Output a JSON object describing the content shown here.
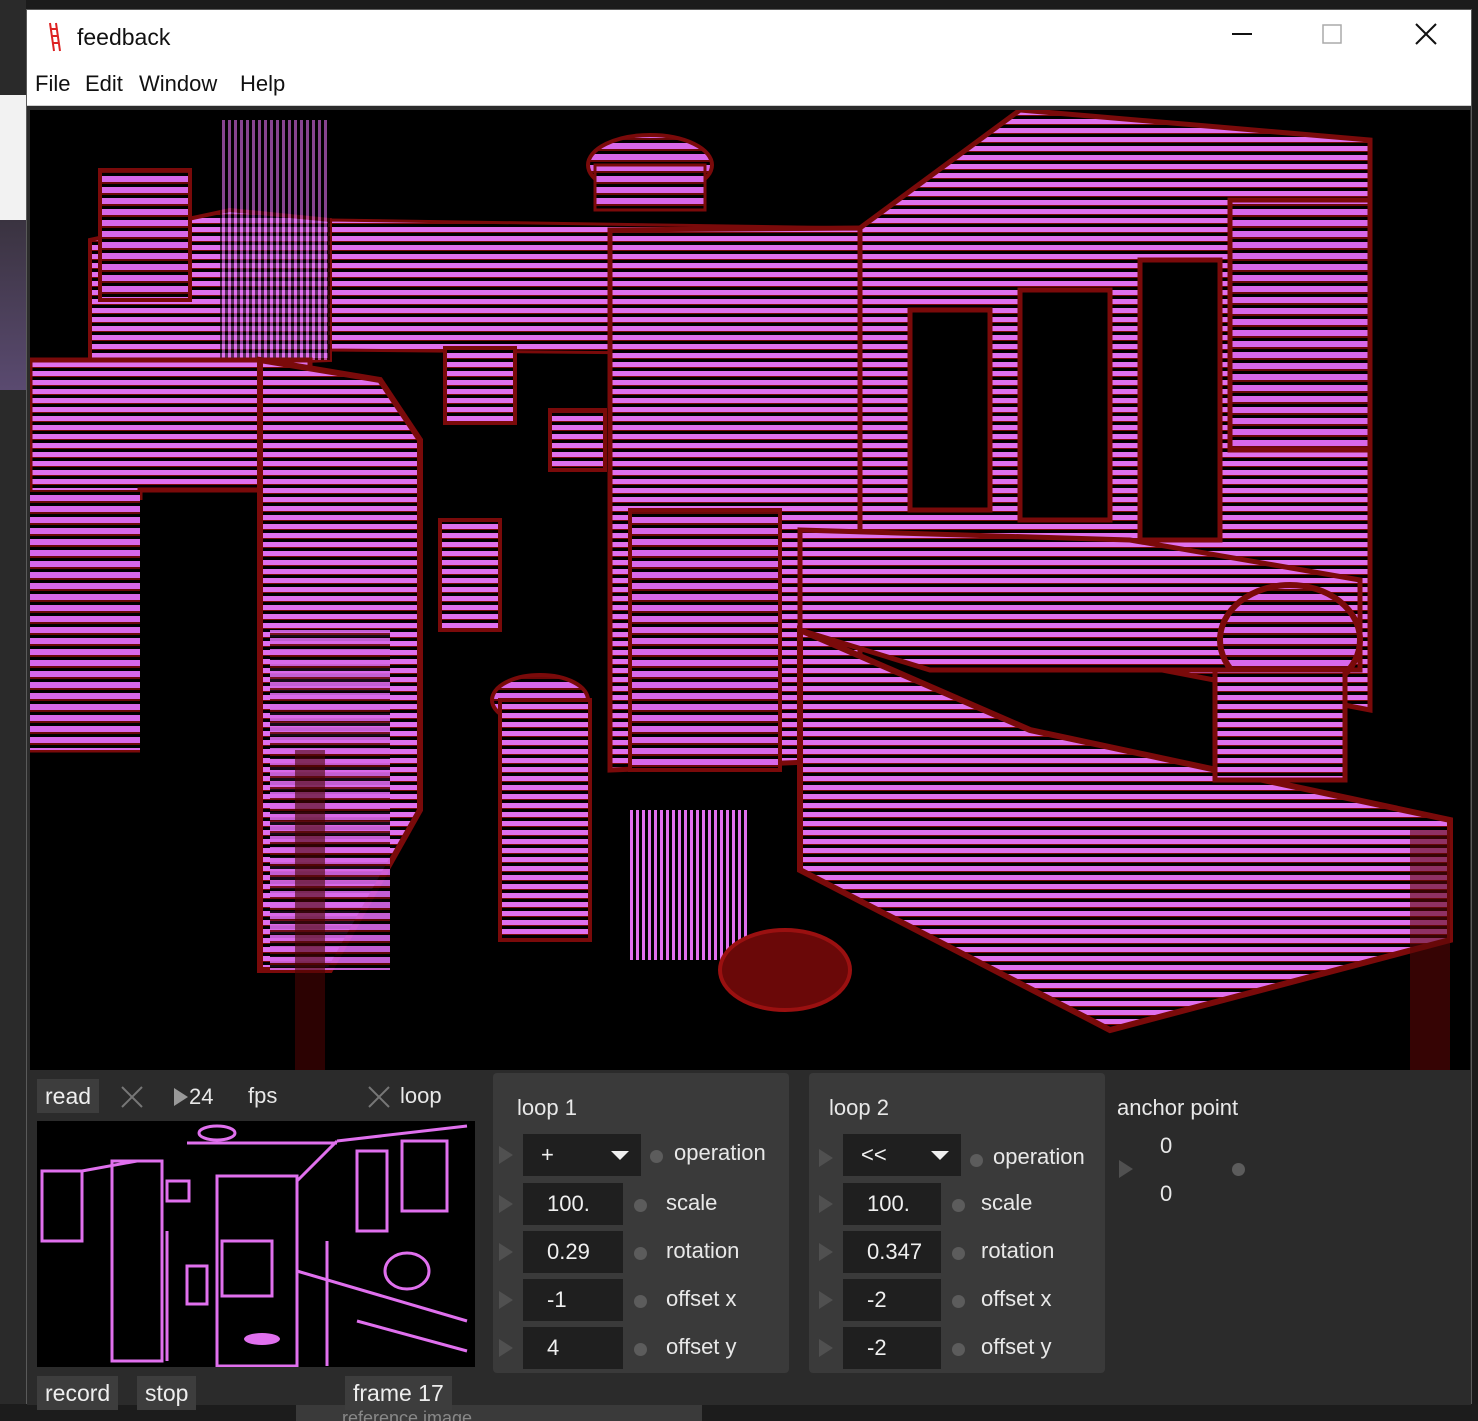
{
  "window": {
    "title": "feedback",
    "app_icon": "ladder-icon"
  },
  "titlebar_buttons": {
    "minimize": "minimize-icon",
    "maximize": "maximize-icon",
    "close": "close-icon"
  },
  "menu": [
    "File",
    "Edit",
    "Window",
    "Help"
  ],
  "player": {
    "read_label": "read",
    "fps_value": "24",
    "fps_label": "fps",
    "loop_label": "loop",
    "record_label": "record",
    "stop_label": "stop",
    "frame_label": "frame 17"
  },
  "loop1": {
    "title": "loop 1",
    "operation_value": "+",
    "operation_label": "operation",
    "scale_value": "100.",
    "scale_label": "scale",
    "rotation_value": "0.29",
    "rotation_label": "rotation",
    "offset_x_value": "-1",
    "offset_x_label": "offset x",
    "offset_y_value": "4",
    "offset_y_label": "offset y"
  },
  "loop2": {
    "title": "loop 2",
    "operation_value": "<<",
    "operation_label": "operation",
    "scale_value": "100.",
    "scale_label": "scale",
    "rotation_value": "0.347",
    "rotation_label": "rotation",
    "offset_x_value": "-2",
    "offset_x_label": "offset x",
    "offset_y_value": "-2",
    "offset_y_label": "offset y"
  },
  "anchor": {
    "title": "anchor point",
    "x": "0",
    "y": "0"
  },
  "background": {
    "tab_label": "reference image"
  },
  "colors": {
    "accent_magenta": "#e070ee",
    "dark_red": "#7a0a0a",
    "panel": "#3a3a3a"
  }
}
